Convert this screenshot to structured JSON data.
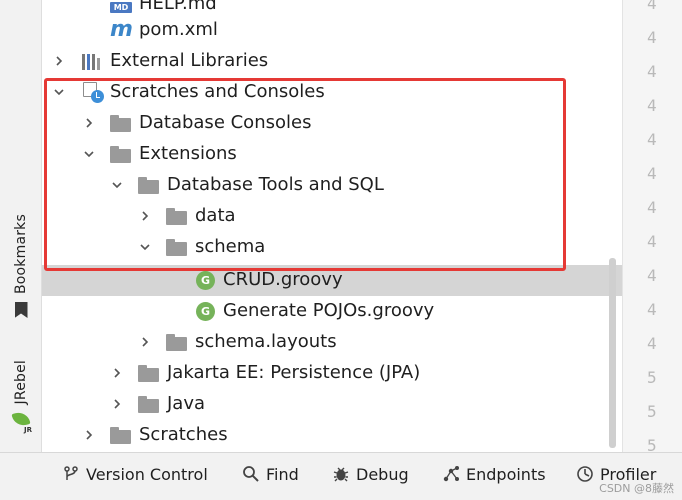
{
  "sidebar": {
    "bookmarks_label": "Bookmarks",
    "jrebel_label": "JRebel"
  },
  "tree": {
    "rows": [
      {
        "label": "HELP.md",
        "icon": "md-file-icon"
      },
      {
        "label": "pom.xml",
        "icon": "maven-icon"
      },
      {
        "label": "External Libraries",
        "icon": "libraries-icon",
        "expanded": false
      },
      {
        "label": "Scratches and Consoles",
        "icon": "scratches-icon",
        "expanded": true
      },
      {
        "label": "Database Consoles",
        "icon": "folder-icon",
        "expanded": false
      },
      {
        "label": "Extensions",
        "icon": "folder-icon",
        "expanded": true
      },
      {
        "label": "Database Tools and SQL",
        "icon": "folder-icon",
        "expanded": true
      },
      {
        "label": "data",
        "icon": "folder-icon",
        "expanded": false
      },
      {
        "label": "schema",
        "icon": "folder-icon",
        "expanded": true
      },
      {
        "label": "CRUD.groovy",
        "icon": "groovy-icon",
        "selected": true
      },
      {
        "label": "Generate POJOs.groovy",
        "icon": "groovy-icon"
      },
      {
        "label": "schema.layouts",
        "icon": "folder-icon",
        "expanded": false
      },
      {
        "label": "Jakarta EE: Persistence (JPA)",
        "icon": "folder-icon",
        "expanded": false
      },
      {
        "label": "Java",
        "icon": "folder-icon",
        "expanded": false
      },
      {
        "label": "Scratches",
        "icon": "folder-icon",
        "expanded": false
      }
    ],
    "md_badge": "MD",
    "m_glyph": "m",
    "groovy_glyph": "G"
  },
  "gutter": {
    "numbers": [
      "4",
      "4",
      "4",
      "4",
      "4",
      "4",
      "4",
      "4",
      "4",
      "4",
      "4",
      "5",
      "5",
      "5"
    ]
  },
  "toolbar": {
    "version_control": "Version Control",
    "find": "Find",
    "debug": "Debug",
    "endpoints": "Endpoints",
    "profiler": "Profiler"
  },
  "watermark": "CSDN @8藤然",
  "colors": {
    "highlight": "#e53935",
    "groovy": "#76b35a",
    "folder": "#9a9a9a",
    "selection": "#d5d5d5"
  }
}
